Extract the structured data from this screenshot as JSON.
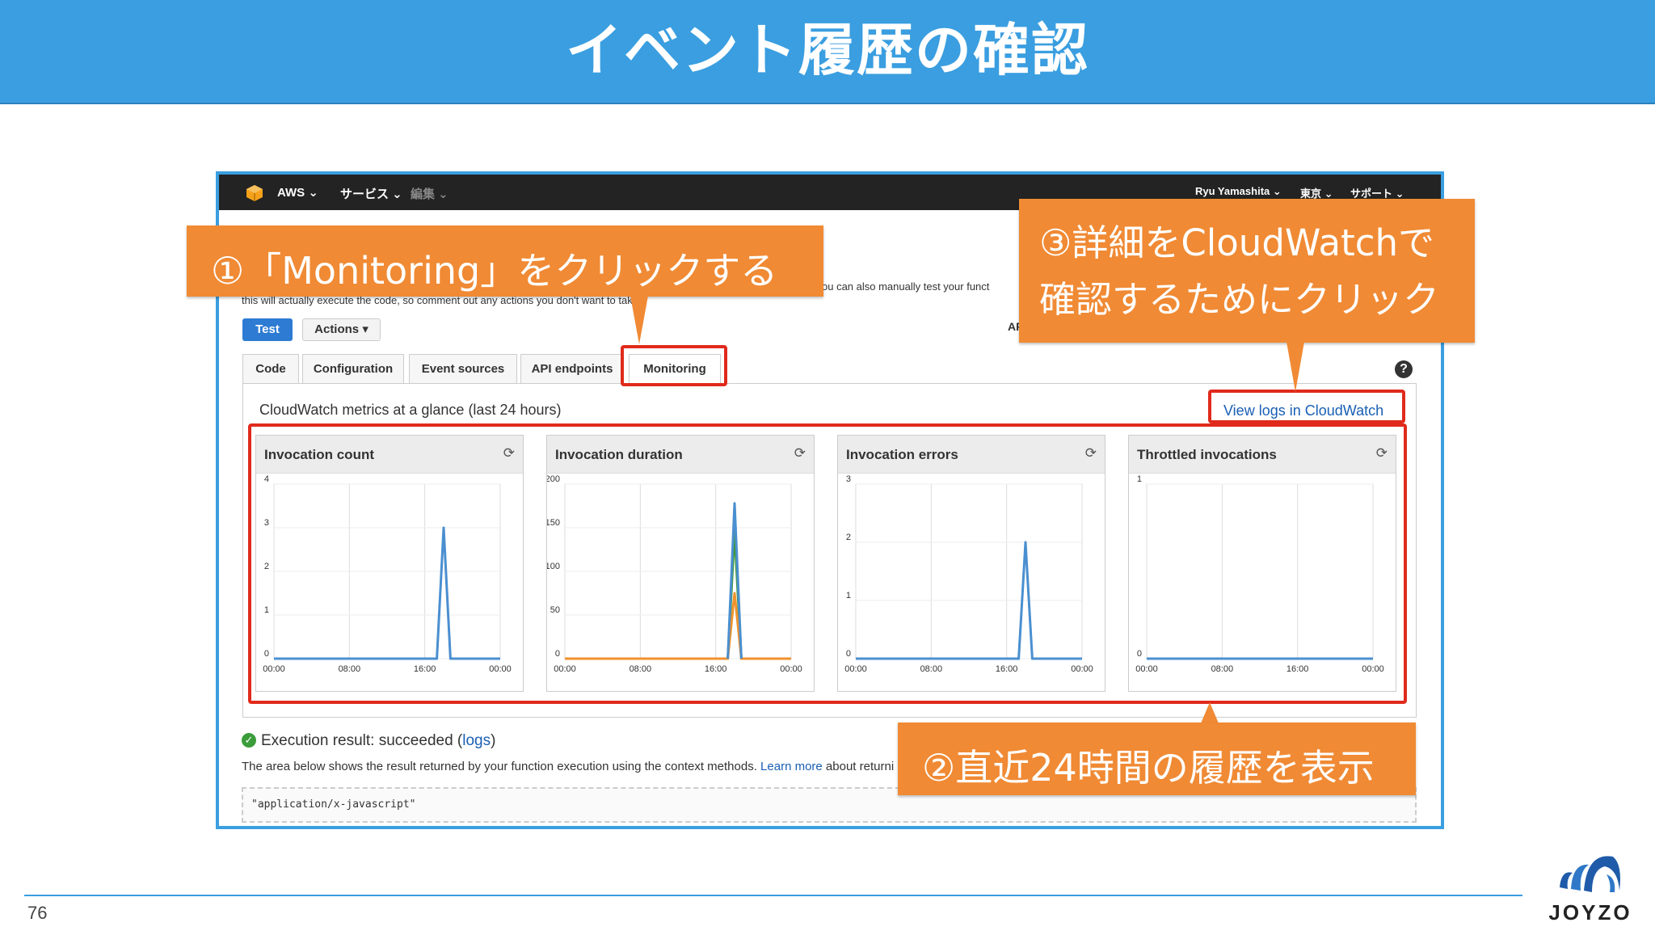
{
  "slide": {
    "title": "イベント履歴の確認",
    "page_number": "76",
    "logo_text": "JOYZO"
  },
  "aws_nav": {
    "items": [
      "AWS ⌄",
      "サービス ⌄",
      "編集 ⌄"
    ],
    "user": "Ryu Yamashita ⌄",
    "region": "東京 ⌄",
    "support": "サポート ⌄"
  },
  "console": {
    "desc_line1_right": "ou can also manually test your funct",
    "desc_line2": "this will actually execute the code, so comment out any actions you don't want to take!",
    "test_button": "Test",
    "actions_button": "Actions ▾",
    "arn_label": "AR",
    "tabs": [
      "Code",
      "Configuration",
      "Event sources",
      "API endpoints",
      "Monitoring"
    ],
    "help_icon_label": "?",
    "cloudwatch_title": "CloudWatch metrics at a glance (last 24 hours)",
    "cloudwatch_link": "View logs in CloudWatch",
    "exec_result_text": "Execution result: succeeded (",
    "exec_result_link": "logs",
    "exec_result_close": ")",
    "area_text_before": "The area below shows the result returned by your function execution using the context methods. ",
    "area_text_link": "Learn more",
    "area_text_after": " about returni",
    "code_output": "\"application/x-javascript\""
  },
  "callouts": {
    "step1": "①「Monitoring」をクリックする",
    "step2": "②直近24時間の履歴を表示",
    "step3_line1": "③詳細をCloudWatchで",
    "step3_line2": "確認するためにクリック"
  },
  "colors": {
    "title_bar": "#3a9ee0",
    "callout": "#f08a34",
    "highlight": "#e02a1c",
    "series_blue": "#4a8fd0",
    "series_green": "#3d9a32",
    "series_orange": "#f0922e"
  },
  "chart_data": [
    {
      "type": "line",
      "title": "Invocation count",
      "x": [
        "00:00",
        "08:00",
        "16:00",
        "00:00"
      ],
      "ylim": [
        0,
        4
      ],
      "yticks": [
        0,
        1,
        2,
        3,
        4
      ],
      "series": [
        {
          "color": "#4a8fd0",
          "points": [
            [
              0,
              0
            ],
            [
              0.72,
              0
            ],
            [
              0.75,
              3
            ],
            [
              0.78,
              0
            ],
            [
              1,
              0
            ]
          ]
        }
      ]
    },
    {
      "type": "line",
      "title": "Invocation duration",
      "x": [
        "00:00",
        "08:00",
        "16:00",
        "00:00"
      ],
      "ylim": [
        0,
        200
      ],
      "yticks": [
        0,
        50,
        100,
        150,
        200
      ],
      "series": [
        {
          "color": "#3d9a32",
          "points": [
            [
              0,
              0
            ],
            [
              0.72,
              0
            ],
            [
              0.75,
              145
            ],
            [
              0.78,
              0
            ],
            [
              1,
              0
            ]
          ]
        },
        {
          "color": "#f0922e",
          "points": [
            [
              0,
              0
            ],
            [
              0.72,
              0
            ],
            [
              0.75,
              75
            ],
            [
              0.78,
              0
            ],
            [
              1,
              0
            ]
          ]
        },
        {
          "color": "#4a8fd0",
          "points": [
            [
              0.72,
              0
            ],
            [
              0.75,
              178
            ],
            [
              0.78,
              0
            ]
          ]
        }
      ]
    },
    {
      "type": "line",
      "title": "Invocation errors",
      "x": [
        "00:00",
        "08:00",
        "16:00",
        "00:00"
      ],
      "ylim": [
        0,
        3
      ],
      "yticks": [
        0,
        1,
        2,
        3
      ],
      "series": [
        {
          "color": "#4a8fd0",
          "points": [
            [
              0,
              0
            ],
            [
              0.72,
              0
            ],
            [
              0.75,
              2
            ],
            [
              0.78,
              0
            ],
            [
              1,
              0
            ]
          ]
        }
      ]
    },
    {
      "type": "line",
      "title": "Throttled invocations",
      "x": [
        "00:00",
        "08:00",
        "16:00",
        "00:00"
      ],
      "ylim": [
        0,
        1
      ],
      "yticks": [
        0,
        1
      ],
      "series": [
        {
          "color": "#4a8fd0",
          "points": [
            [
              0,
              0
            ],
            [
              1,
              0
            ]
          ]
        }
      ]
    }
  ]
}
